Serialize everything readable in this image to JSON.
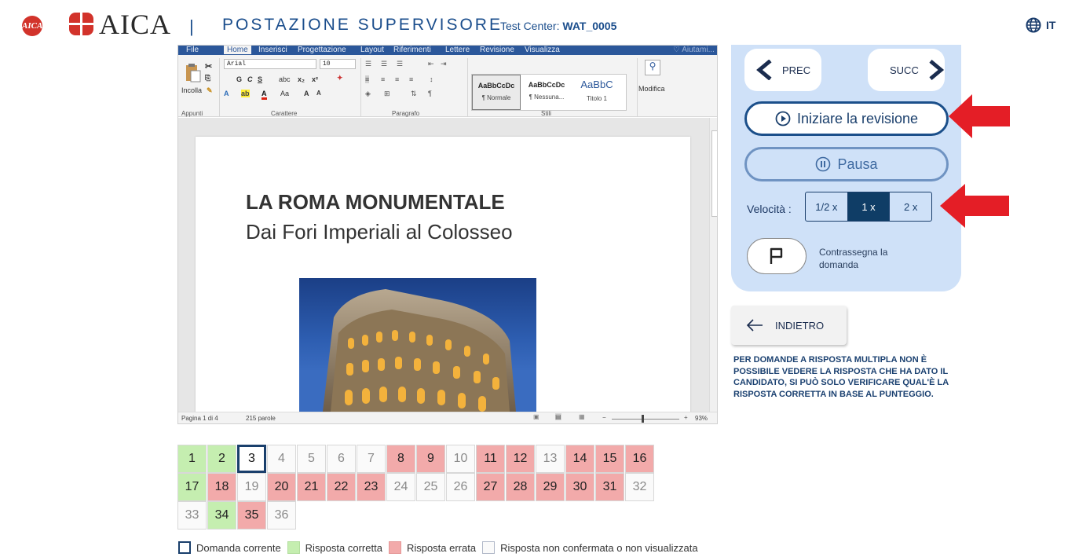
{
  "header": {
    "logo_small_text": "AICA",
    "logo_text": "AICA",
    "separator": "|",
    "title": "POSTAZIONE SUPERVISORE",
    "test_center_label": "Test Center:",
    "test_center_value": "WAT_0005",
    "language": "IT",
    "brand_color": "#d2332b",
    "title_color": "#1a4d8c"
  },
  "word": {
    "tabs": [
      "File",
      "Home",
      "Inserisci",
      "Progettazione",
      "Layout",
      "Riferimenti",
      "Lettere",
      "Revisione",
      "Visualizza"
    ],
    "tell_me": "Aiutami",
    "clipboard_label": "Incolla",
    "font_name": "Arial",
    "font_size": "10",
    "group_labels": [
      "Appunti",
      "Carattere",
      "Paragrafo",
      "Stili"
    ],
    "styles": [
      {
        "sample": "AaBbCcDc",
        "name": "¶ Normale"
      },
      {
        "sample": "AaBbCcDc",
        "name": "¶ Nessuna..."
      },
      {
        "sample": "AaBbC",
        "name": "Titolo 1"
      }
    ],
    "modify_label": "Modifica",
    "doc_title": "LA ROMA MONUMENTALE",
    "doc_subtitle": "Dai Fori Imperiali al Colosseo",
    "status_page": "Pagina 1 di 4",
    "status_words": "215 parole",
    "zoom": "93%",
    "accent": "#2b579a"
  },
  "panel": {
    "prev_label": "PREC",
    "next_label": "SUCC",
    "start_label": "Iniziare la revisione",
    "pause_label": "Pausa",
    "speed_label": "Velocità :",
    "speed_options": [
      "1/2 x",
      "1 x",
      "2 x"
    ],
    "speed_selected": "1 x",
    "flag_label": "Contrassegna la domanda",
    "back_label": "INDIETRO",
    "note": "Per domande a risposta multipla non è possibile vedere la risposta che ha dato il candidato, si può solo verificare qual'è la risposta corretta in base al punteggio.",
    "panel_color": "#cfe1f8",
    "arrow_color": "#e41e26"
  },
  "questions": [
    {
      "n": "1",
      "s": "correct"
    },
    {
      "n": "2",
      "s": "correct"
    },
    {
      "n": "3",
      "s": "current"
    },
    {
      "n": "4",
      "s": "unconfirmed"
    },
    {
      "n": "5",
      "s": "unconfirmed"
    },
    {
      "n": "6",
      "s": "unconfirmed"
    },
    {
      "n": "7",
      "s": "unconfirmed"
    },
    {
      "n": "8",
      "s": "wrong"
    },
    {
      "n": "9",
      "s": "wrong"
    },
    {
      "n": "10",
      "s": "unconfirmed"
    },
    {
      "n": "11",
      "s": "wrong"
    },
    {
      "n": "12",
      "s": "wrong"
    },
    {
      "n": "13",
      "s": "unconfirmed"
    },
    {
      "n": "14",
      "s": "wrong"
    },
    {
      "n": "15",
      "s": "wrong"
    },
    {
      "n": "16",
      "s": "wrong"
    },
    {
      "n": "17",
      "s": "correct"
    },
    {
      "n": "18",
      "s": "wrong"
    },
    {
      "n": "19",
      "s": "unconfirmed"
    },
    {
      "n": "20",
      "s": "wrong"
    },
    {
      "n": "21",
      "s": "wrong"
    },
    {
      "n": "22",
      "s": "wrong"
    },
    {
      "n": "23",
      "s": "wrong"
    },
    {
      "n": "24",
      "s": "unconfirmed"
    },
    {
      "n": "25",
      "s": "unconfirmed"
    },
    {
      "n": "26",
      "s": "unconfirmed"
    },
    {
      "n": "27",
      "s": "wrong"
    },
    {
      "n": "28",
      "s": "wrong"
    },
    {
      "n": "29",
      "s": "wrong"
    },
    {
      "n": "30",
      "s": "wrong"
    },
    {
      "n": "31",
      "s": "wrong"
    },
    {
      "n": "32",
      "s": "unconfirmed"
    },
    {
      "n": "33",
      "s": "unconfirmed"
    },
    {
      "n": "34",
      "s": "correct"
    },
    {
      "n": "35",
      "s": "wrong"
    },
    {
      "n": "36",
      "s": "unconfirmed"
    }
  ],
  "legend": [
    {
      "label": "Domanda corrente",
      "key": "current",
      "color": "#ffffff"
    },
    {
      "label": "Risposta corretta",
      "key": "correct",
      "color": "#c5eeb0"
    },
    {
      "label": "Risposta errata",
      "key": "wrong",
      "color": "#f2aaaa"
    },
    {
      "label": "Risposta non confermata o non visualizzata",
      "key": "unconfirmed",
      "color": "#fafafa"
    }
  ]
}
